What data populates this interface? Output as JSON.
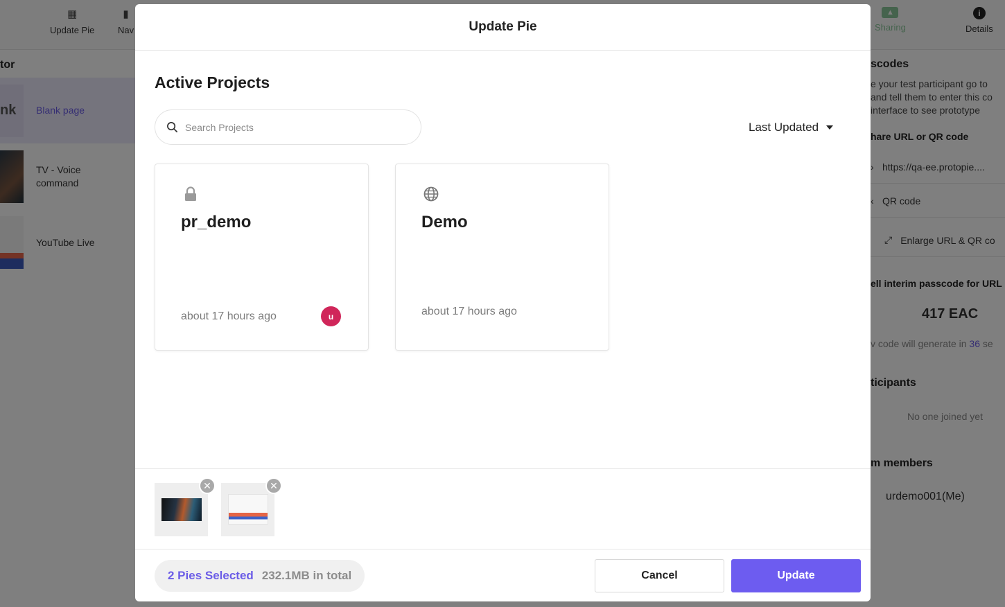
{
  "background": {
    "toolbar": {
      "update_pie_label": "Update Pie",
      "nav_label": "Nav",
      "sharing_label": "Sharing",
      "details_label": "Details"
    },
    "left_panel": {
      "title": "tor",
      "pages": [
        {
          "thumb_text": "nk",
          "label": "Blank page"
        },
        {
          "label": "TV - Voice command"
        },
        {
          "label": "YouTube Live"
        }
      ]
    },
    "right_panel": {
      "passcodes_title": "scodes",
      "passcodes_desc": "e your test participant go to and tell them to enter this co interface to see prototype",
      "share_title": "hare URL or QR code",
      "url_text": "https://qa-ee.protopie....",
      "qr_label": "QR code",
      "enlarge_label": "Enlarge URL & QR co",
      "interim_title": "ell interim passcode for URL",
      "passcode": "417 EAC",
      "regen_prefix": "v code will generate in",
      "regen_seconds": "36",
      "regen_suffix": "se",
      "participants_title": "ticipants",
      "participants_empty": "No one joined yet",
      "team_title": "m members",
      "team_member": "urdemo001(Me)"
    }
  },
  "modal": {
    "title": "Update Pie",
    "section_title": "Active Projects",
    "search": {
      "placeholder": "Search Projects",
      "value": ""
    },
    "sort": {
      "label": "Last Updated"
    },
    "projects": [
      {
        "name": "pr_demo",
        "icon": "lock-icon",
        "updated": "about 17 hours ago",
        "avatar_initial": "u",
        "avatar_color": "#d0265a"
      },
      {
        "name": "Demo",
        "icon": "globe-icon",
        "updated": "about 17 hours ago"
      }
    ],
    "selected_pies": [
      {
        "name": "TV - Voice command"
      },
      {
        "name": "YouTube Live"
      }
    ],
    "footer": {
      "selected_count": "2 Pies Selected",
      "total_size": "232.1MB in total",
      "cancel_label": "Cancel",
      "update_label": "Update"
    }
  },
  "colors": {
    "accent": "#6d5cf0",
    "accent_text": "#6b5ce7",
    "avatar": "#d0265a",
    "sharing_green": "#8bc79a"
  }
}
